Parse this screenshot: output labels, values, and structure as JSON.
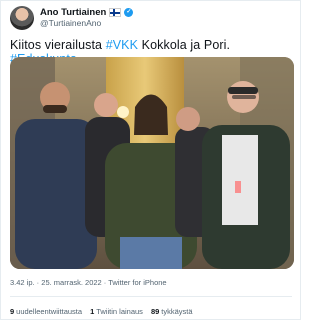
{
  "author": {
    "name": "Ano Turtiainen",
    "handle": "@TurtiainenAno"
  },
  "tweet": {
    "text_plain": "Kiitos vierailusta ",
    "hashtag1": "#VKK",
    "text_mid": " Kokkola ja Pori. ",
    "hashtag2": "#Eduskunta",
    "timestamp": "3.42 ip. · 25. marrask. 2022 · Twitter for iPhone"
  },
  "stats": {
    "retweets_count": "9",
    "retweets_label": "uudelleentwiittausta",
    "quotes_count": "1",
    "quotes_label": "Twiitin lainaus",
    "likes_count": "89",
    "likes_label": "tykkäystä"
  },
  "colors": {
    "link": "#1d9bf0",
    "muted": "#536471",
    "text": "#0f1419"
  }
}
